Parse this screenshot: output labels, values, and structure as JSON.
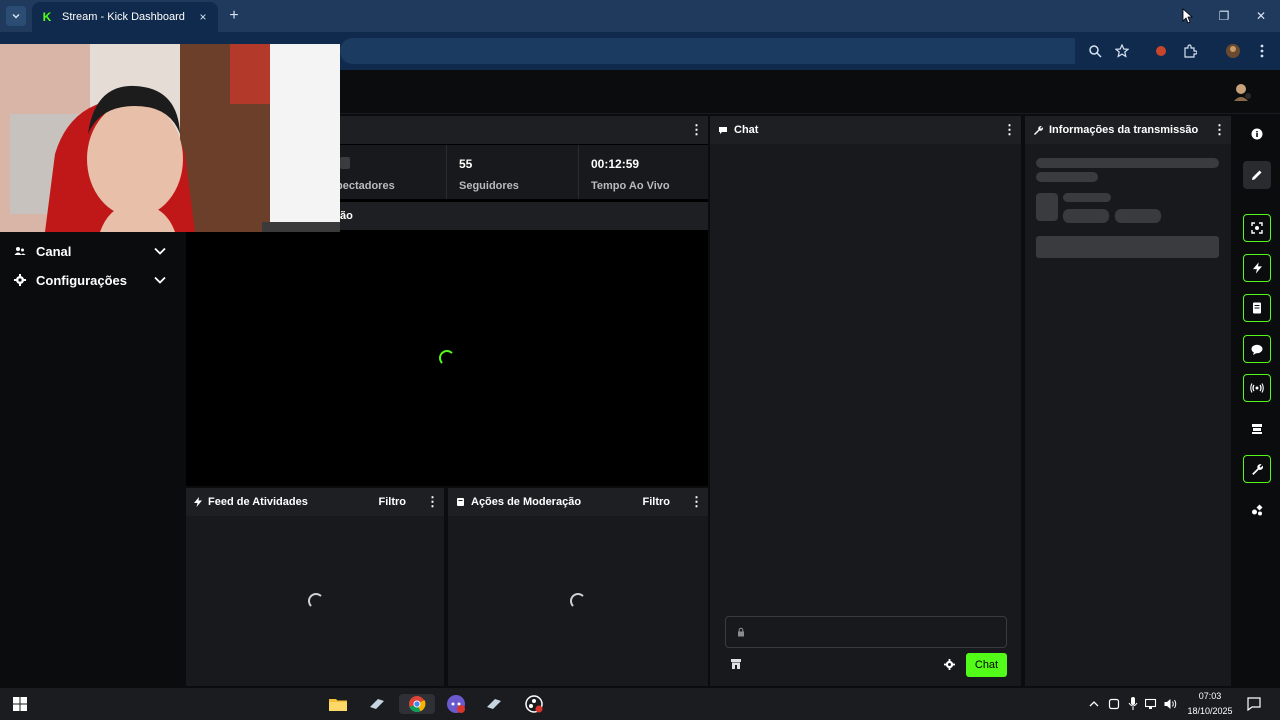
{
  "browser": {
    "tab_title": "Stream - Kick Dashboard",
    "tab_favicon": "K",
    "tab_close": "×",
    "new_tab": "+",
    "minimize": "—",
    "restore": "❐",
    "close": "✕"
  },
  "sidebar": {
    "items": [
      {
        "label": "Canal",
        "icon": "users-icon"
      },
      {
        "label": "Configurações",
        "icon": "gear-icon"
      }
    ]
  },
  "stats": {
    "viewers_label": "Espectadores",
    "viewers_visible_label": "pectadores",
    "followers_value": "55",
    "followers_label": "Seguidores",
    "live_time_value": "00:12:59",
    "live_time_label": "Tempo Ao Vivo"
  },
  "preview": {
    "section_label_visible": "ão"
  },
  "panels": {
    "chat_title": "Chat",
    "stream_info_title": "Informações da transmissão",
    "activity_feed_title": "Feed de Atividades",
    "moderation_title": "Ações de Moderação",
    "filter_label": "Filtro",
    "kebab": "⋮"
  },
  "chat": {
    "input_placeholder": "",
    "send_label": "Chat"
  },
  "taskbar": {
    "time": "07:03",
    "date": "18/10/2025"
  },
  "colors": {
    "accent": "#53fc18",
    "panel_bg": "#18191c",
    "panel_head": "#1e1f22",
    "page_bg": "#0b0c0e",
    "browser_tab_bar": "#1f3a5c"
  }
}
